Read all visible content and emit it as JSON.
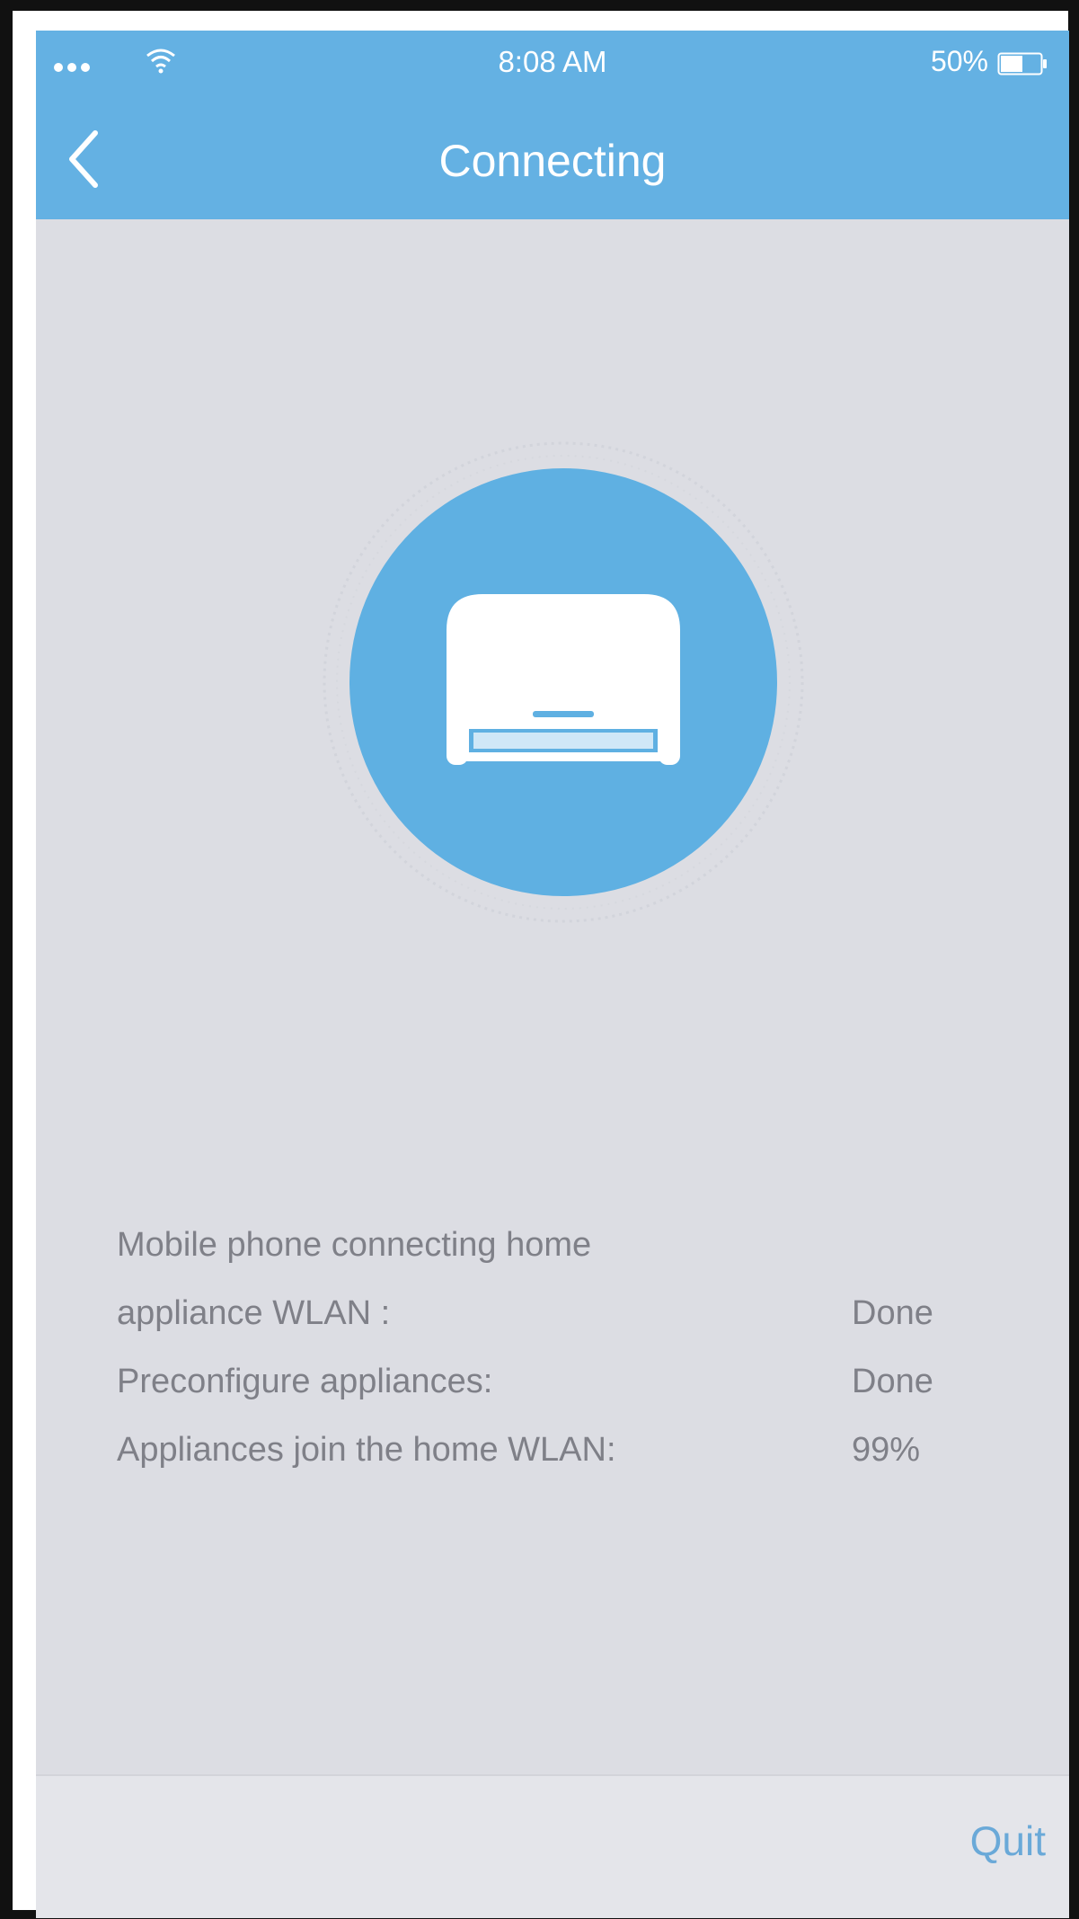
{
  "status_bar": {
    "time": "8:08 AM",
    "battery": "50%"
  },
  "nav": {
    "title": "Connecting",
    "back_icon": "chevron-left-icon"
  },
  "graphic": {
    "icon": "air-conditioner-icon"
  },
  "progress": {
    "rows": [
      {
        "label": "Mobile phone connecting home",
        "status": ""
      },
      {
        "label": "appliance WLAN :",
        "status": "Done"
      },
      {
        "label": "Preconfigure appliances:",
        "status": "Done"
      },
      {
        "label": "Appliances join the home WLAN:",
        "status": "99%"
      }
    ]
  },
  "footer": {
    "quit_label": "Quit"
  },
  "colors": {
    "header": "#64b1e3",
    "background": "#dcdde3",
    "circle": "#5fb0e2",
    "text": "#7f8088",
    "accent": "#6aa9d8"
  }
}
